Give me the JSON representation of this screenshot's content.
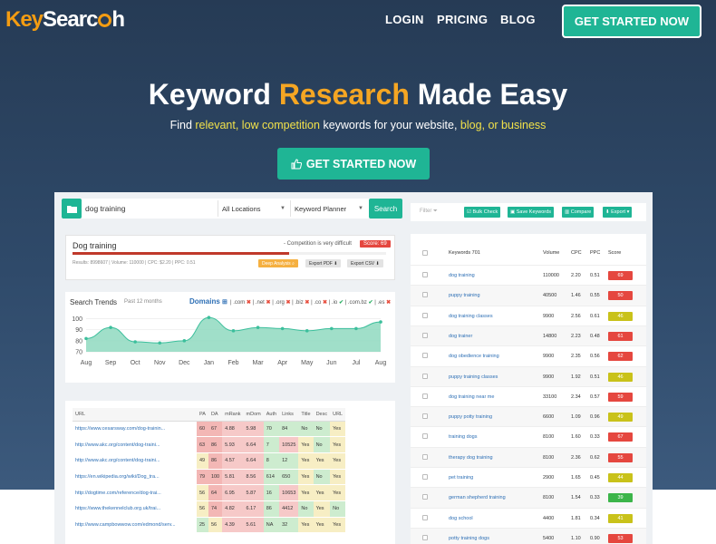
{
  "nav": {
    "logo_part1": "Key",
    "logo_part2": "Searc",
    "logo_part3": "h",
    "login": "LOGIN",
    "pricing": "PRICING",
    "blog": "BLOG",
    "cta": "GET STARTED NOW"
  },
  "hero": {
    "headline_1": "Keyword ",
    "headline_accent": "Research",
    "headline_2": " Made Easy",
    "sub_1": "Find ",
    "sub_hl_1": "relevant, low competition",
    "sub_2": " keywords for your website, ",
    "sub_hl_2": "blog, or business",
    "cta": "GET STARTED NOW",
    "cta_icon": "thumbs-up-icon"
  },
  "app": {
    "search": {
      "keyword": "dog training",
      "location": "All Locations",
      "source": "Keyword Planner",
      "button": "Search"
    },
    "keyword_card": {
      "title": "Dog training",
      "difficulty": "- Competition is very difficult",
      "score": "Score: 69",
      "score_value": 69,
      "meta": "Results: 8998607 | Volume: 110000 | CPC: $2.20 | PPC: 0.51",
      "deep_analysis": "Deep Analysis",
      "export_pdf": "Export PDF",
      "export_csv": "Export CSV"
    },
    "trends": {
      "title": "Search Trends",
      "subtitle": "Past 12 months",
      "domains_label": "Domains",
      "tlds": [
        {
          "label": ".com",
          "ok": false
        },
        {
          "label": ".net",
          "ok": false
        },
        {
          "label": ".org",
          "ok": false
        },
        {
          "label": ".biz",
          "ok": false
        },
        {
          "label": ".co",
          "ok": false
        },
        {
          "label": ".io",
          "ok": true
        },
        {
          "label": ".com.bz",
          "ok": true
        },
        {
          "label": ".es",
          "ok": false
        }
      ]
    },
    "url_table": {
      "headers": [
        "URL",
        "PA",
        "DA",
        "mRank",
        "mDom",
        "Auth",
        "Links",
        "Title",
        "Desc",
        "URL"
      ],
      "rows": [
        [
          "https://www.cesarsway.com/dog-trainin...",
          "60",
          "67",
          "4.88",
          "5.98",
          "70",
          "84",
          "No",
          "No",
          "Yes"
        ],
        [
          "http://www.akc.org/content/dog-traini...",
          "63",
          "86",
          "5.93",
          "6.64",
          "7",
          "10525",
          "Yes",
          "No",
          "Yes"
        ],
        [
          "http://www.akc.org/content/dog-traini...",
          "49",
          "86",
          "4.57",
          "6.64",
          "8",
          "12",
          "Yes",
          "Yes",
          "Yes"
        ],
        [
          "https://en.wikipedia.org/wiki/Dog_tra...",
          "79",
          "100",
          "5.81",
          "8.56",
          "614",
          "650",
          "Yes",
          "No",
          "Yes"
        ],
        [
          "http://dogtime.com/reference/dog-trai...",
          "56",
          "64",
          "6.95",
          "5.87",
          "16",
          "10653",
          "Yes",
          "Yes",
          "Yes"
        ],
        [
          "https://www.thekennelclub.org.uk/trai...",
          "56",
          "74",
          "4.82",
          "6.17",
          "86",
          "4412",
          "No",
          "Yes",
          "No"
        ],
        [
          "http://www.campbowwow.com/edmond/serv...",
          "25",
          "56",
          "4.39",
          "5.61",
          "NA",
          "32",
          "Yes",
          "Yes",
          "Yes"
        ]
      ]
    },
    "toolbar": {
      "filter": "Filter",
      "bulk_check": "Bulk Check",
      "save_keywords": "Save Keywords",
      "compare": "Compare",
      "export": "Export"
    },
    "keywords_table": {
      "headers": {
        "keyword": "Keywords 701",
        "volume": "Volume",
        "cpc": "CPC",
        "ppc": "PPC",
        "score": "Score"
      },
      "rows": [
        {
          "kw": "dog training",
          "vol": "110000",
          "cpc": "2.20",
          "ppc": "0.51",
          "score": "69"
        },
        {
          "kw": "puppy training",
          "vol": "40500",
          "cpc": "1.46",
          "ppc": "0.55",
          "score": "50"
        },
        {
          "kw": "dog training classes",
          "vol": "9900",
          "cpc": "2.56",
          "ppc": "0.61",
          "score": "46"
        },
        {
          "kw": "dog trainer",
          "vol": "14800",
          "cpc": "2.23",
          "ppc": "0.48",
          "score": "61"
        },
        {
          "kw": "dog obedience training",
          "vol": "9900",
          "cpc": "2.35",
          "ppc": "0.56",
          "score": "62"
        },
        {
          "kw": "puppy training classes",
          "vol": "9900",
          "cpc": "1.92",
          "ppc": "0.51",
          "score": "46"
        },
        {
          "kw": "dog training near me",
          "vol": "33100",
          "cpc": "2.34",
          "ppc": "0.57",
          "score": "59"
        },
        {
          "kw": "puppy potty training",
          "vol": "6600",
          "cpc": "1.09",
          "ppc": "0.96",
          "score": "49"
        },
        {
          "kw": "training dogs",
          "vol": "8100",
          "cpc": "1.60",
          "ppc": "0.33",
          "score": "67"
        },
        {
          "kw": "therapy dog training",
          "vol": "8100",
          "cpc": "2.36",
          "ppc": "0.62",
          "score": "55"
        },
        {
          "kw": "pet training",
          "vol": "2900",
          "cpc": "1.65",
          "ppc": "0.45",
          "score": "44"
        },
        {
          "kw": "german shepherd training",
          "vol": "8100",
          "cpc": "1.54",
          "ppc": "0.33",
          "score": "39"
        },
        {
          "kw": "dog school",
          "vol": "4400",
          "cpc": "1.81",
          "ppc": "0.34",
          "score": "41"
        },
        {
          "kw": "potty training dogs",
          "vol": "5400",
          "cpc": "1.10",
          "ppc": "0.90",
          "score": "53"
        }
      ]
    }
  },
  "colors": {
    "accent": "#1fb595",
    "orange": "#f5a623",
    "score_red": "#e5473f",
    "score_yellow": "#c9c21a",
    "score_green": "#3cb54a",
    "trend_fill": "#8fd9c0",
    "trend_line": "#3cbf9c"
  },
  "chart_data": {
    "type": "area",
    "categories": [
      "Aug",
      "Sep",
      "Oct",
      "Nov",
      "Dec",
      "Jan",
      "Feb",
      "Mar",
      "Apr",
      "May",
      "Jun",
      "Jul",
      "Aug"
    ],
    "values": [
      82,
      92,
      79,
      78,
      80,
      101,
      89,
      92,
      91,
      89,
      91,
      91,
      97
    ],
    "y_ticks": [
      "100",
      "90",
      "80",
      "70"
    ],
    "ylim": [
      70,
      102
    ],
    "grid": true
  }
}
